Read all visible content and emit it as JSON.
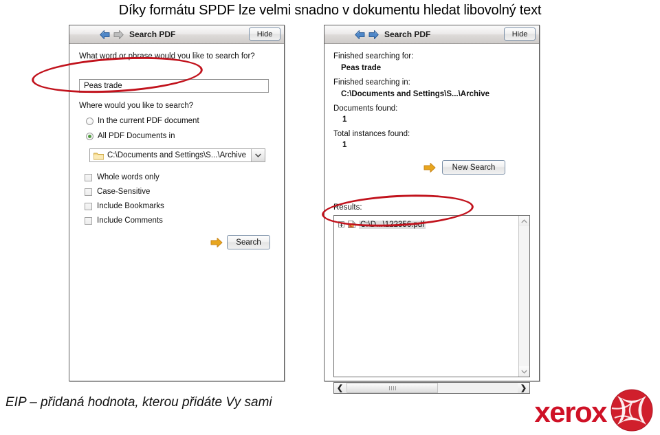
{
  "slide": {
    "title": "Díky formátu SPDF lze velmi snadno v dokumentu hledat libovolný text",
    "footer": "EIP – přidaná hodnota, kterou přidáte Vy sami",
    "logo_word": "xerox",
    "annotation_color": "#c1121c"
  },
  "left_panel": {
    "header": {
      "title": "Search PDF",
      "hide_label": "Hide",
      "back_icon": "arrow-left-icon",
      "forward_icon": "arrow-right-icon"
    },
    "prompt": "What word or phrase would you like to search for?",
    "search_value": "Peas trade",
    "where_label": "Where would you like to search?",
    "radios": [
      {
        "label": "In the current PDF document",
        "selected": false
      },
      {
        "label": "All PDF Documents in",
        "selected": true
      }
    ],
    "folder_combo": {
      "value": "C:\\Documents and Settings\\S...\\Archive",
      "icon": "folder-icon",
      "dropdown_icon": "chevron-down-icon"
    },
    "checkboxes": [
      {
        "label": "Whole words only",
        "checked": false
      },
      {
        "label": "Case-Sensitive",
        "checked": false
      },
      {
        "label": "Include Bookmarks",
        "checked": false
      },
      {
        "label": "Include Comments",
        "checked": false
      }
    ],
    "search_button": "Search"
  },
  "right_panel": {
    "header": {
      "title": "Search PDF",
      "hide_label": "Hide",
      "back_icon": "arrow-left-icon",
      "forward_icon": "arrow-right-icon"
    },
    "finished_for_label": "Finished searching for:",
    "finished_for_value": "Peas trade",
    "finished_in_label": "Finished searching in:",
    "finished_in_value": "C:\\Documents and Settings\\S...\\Archive",
    "documents_found_label": "Documents found:",
    "documents_found_value": "1",
    "total_instances_label": "Total instances found:",
    "total_instances_value": "1",
    "new_search_button": "New Search",
    "results_label": "Results:",
    "result_item": "C:\\D...\\122356.pdf"
  }
}
